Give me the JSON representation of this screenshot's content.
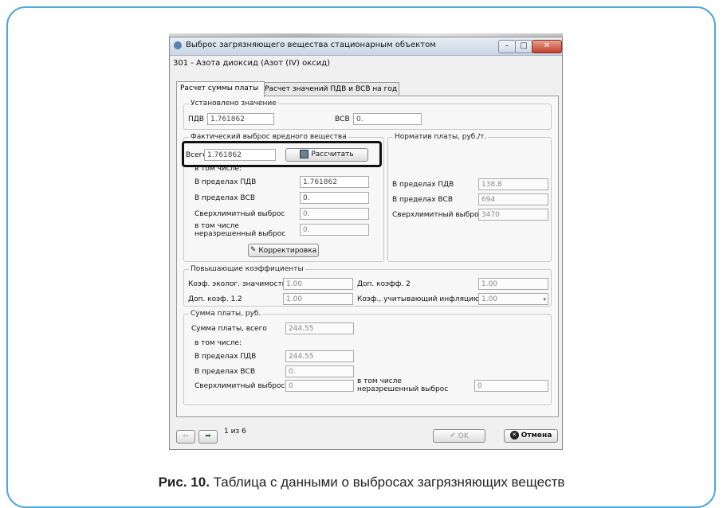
{
  "window": {
    "title": "Выброс загрязняющего вещества стационарным объектом",
    "substance": "301 - Азота диоксид (Азот (IV) оксид)"
  },
  "tabs": [
    "Расчет суммы платы",
    "Расчет значений ПДВ и ВСВ на год"
  ],
  "established": {
    "legend": "Установлено значение",
    "pdv_label": "ПДВ",
    "pdv_value": "1.761862",
    "vsv_label": "ВСВ",
    "vsv_value": "0."
  },
  "actual": {
    "legend": "Фактический выброс вредного вещества",
    "total_label": "Всего",
    "total_value": "1.761862",
    "calc_button": "Рассчитать",
    "including": "в том числе:",
    "within_pdv_label": "В пределах ПДВ",
    "within_pdv_value": "1.761862",
    "within_vsv_label": "В пределах ВСВ",
    "within_vsv_value": "0.",
    "over_label": "Сверхлимитный выброс",
    "over_value": "0.",
    "unauth_label_1": "в том числе",
    "unauth_label_2": "неразрешенный выброс",
    "unauth_value": "0.",
    "correct_button": "Корректировка"
  },
  "norm": {
    "legend": "Норматив платы, руб./т.",
    "pdv_label": "В пределах ПДВ",
    "pdv_value": "138.8",
    "vsv_label": "В пределах ВСВ",
    "vsv_value": "694",
    "over_label": "Сверхлимитный выброс",
    "over_value": "3470"
  },
  "coef": {
    "legend": "Повышающие коэффициенты",
    "eco_label": "Коэф. эколог. значимости",
    "eco_value": "1.00",
    "add2_label": "Доп. коэфф. 2",
    "add2_value": "1.00",
    "add12_label": "Доп. коэф. 1.2",
    "add12_value": "1.00",
    "infl_label": "Коэф., учитывающий инфляцию",
    "infl_value": "1.00"
  },
  "sum": {
    "legend": "Сумма платы, руб.",
    "total_label": "Сумма платы, всего",
    "total_value": "244.55",
    "including": "в том числе:",
    "pdv_label": "В пределах ПДВ",
    "pdv_value": "244.55",
    "vsv_label": "В пределах ВСВ",
    "vsv_value": "0.",
    "over_label": "Сверхлимитный выброс",
    "over_value": "0",
    "unauth_label_1": "в том числе",
    "unauth_label_2": "неразрешенный выброс",
    "unauth_value": "0"
  },
  "footer": {
    "page_info": "1 из 6",
    "ok_label": "OK",
    "cancel_label": "Отмена"
  },
  "caption": {
    "label": "Рис. 10.",
    "text": " Таблица с данными о выбросах загрязняющих веществ"
  },
  "colors": {
    "frame": "#4ba8d8",
    "close_button": "#c0402a",
    "highlight": "#111111"
  }
}
